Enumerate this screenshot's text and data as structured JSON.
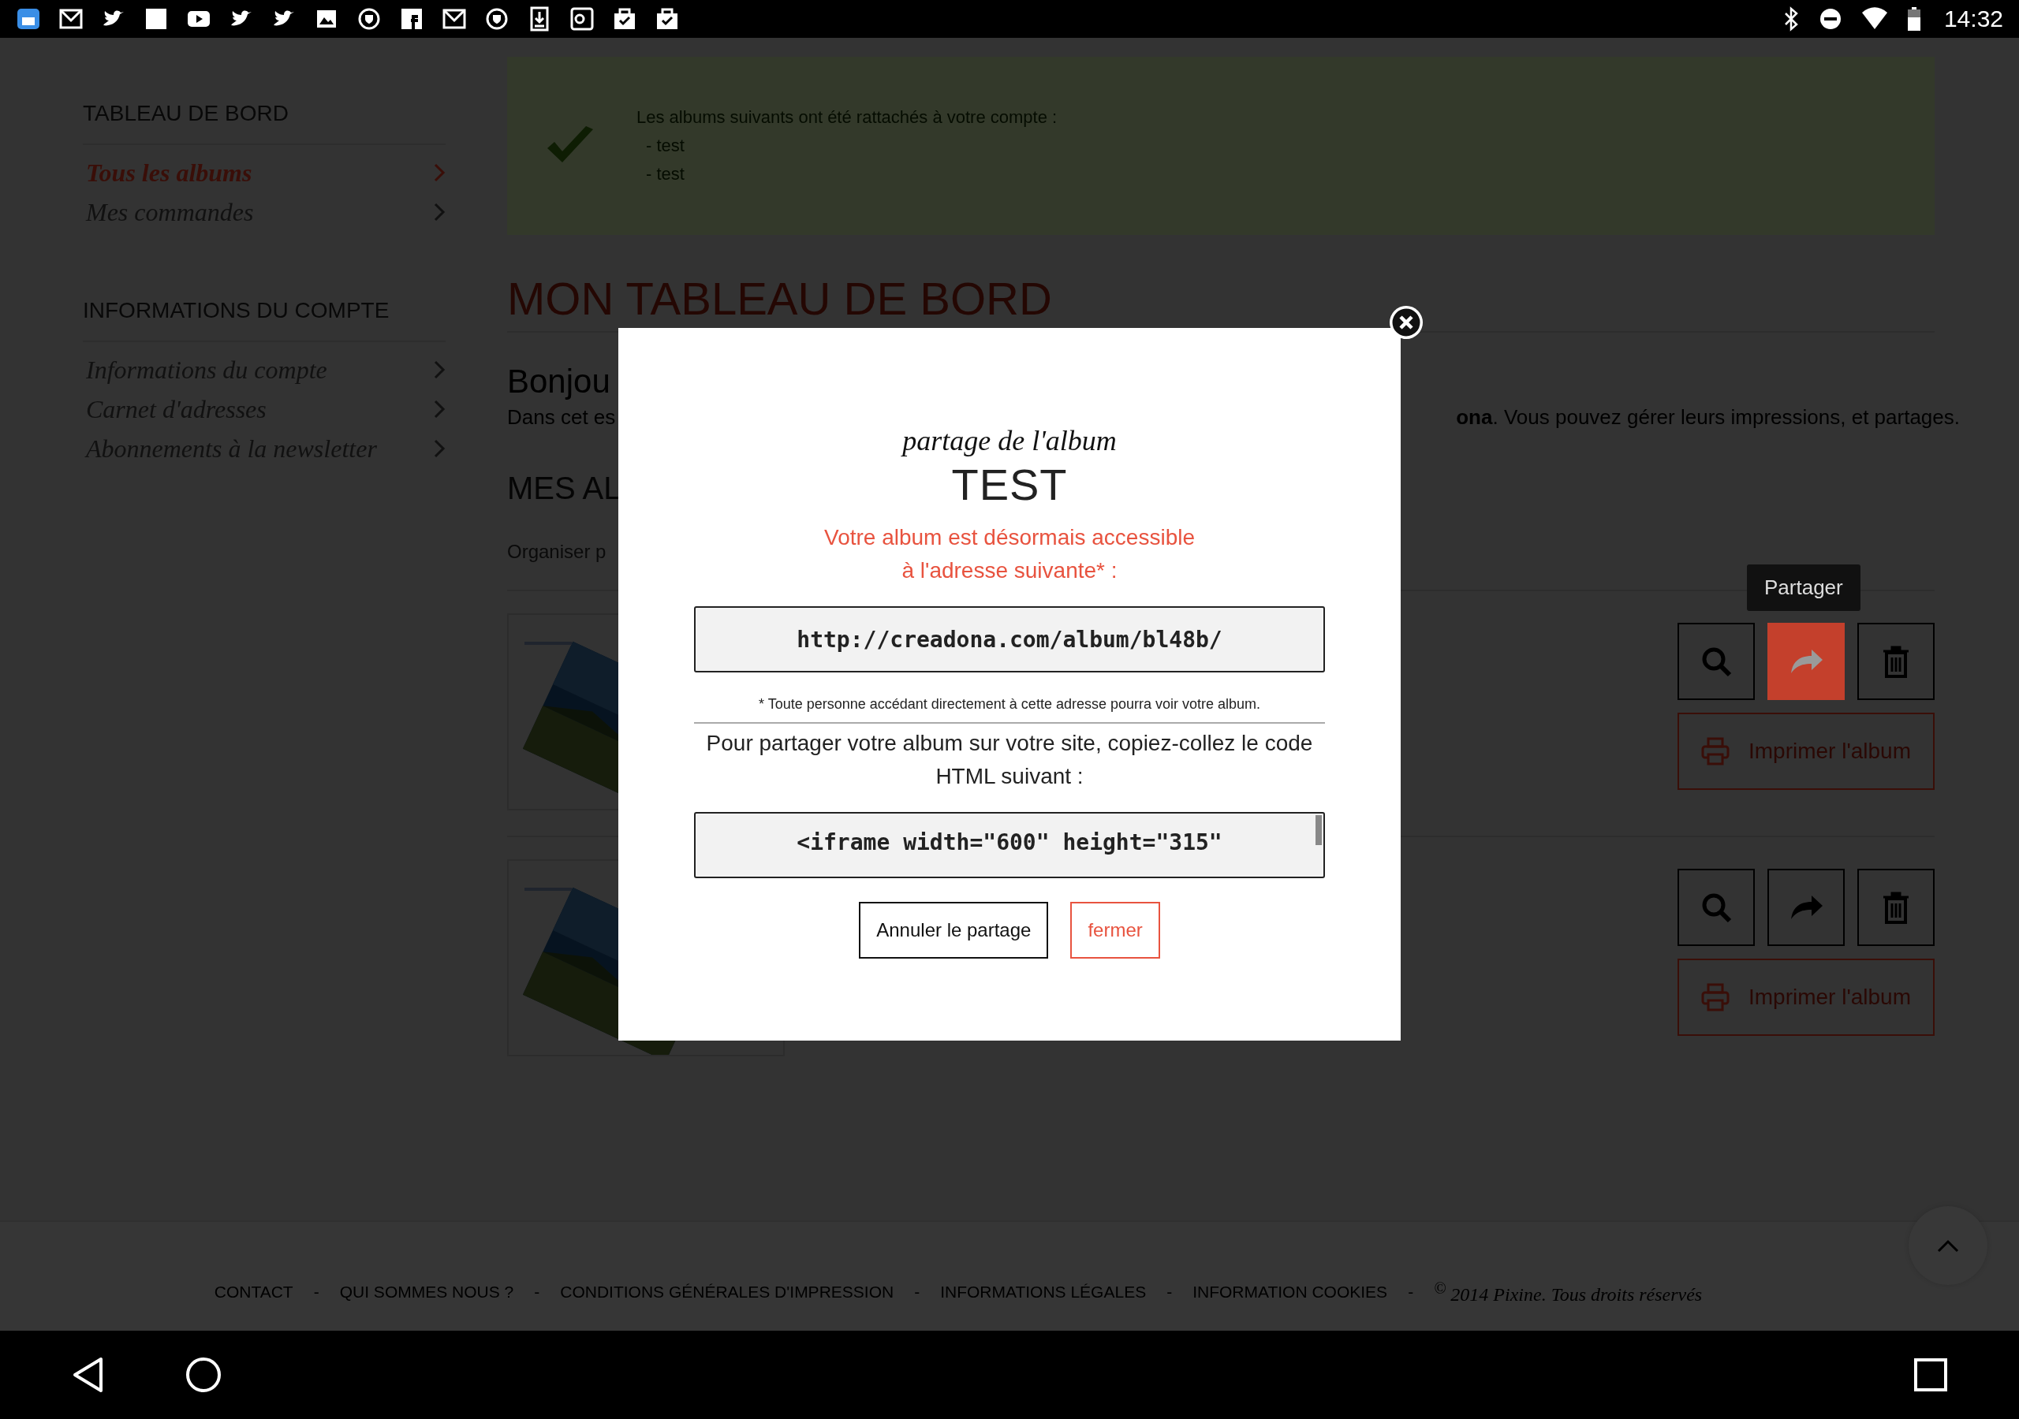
{
  "status_bar": {
    "time": "14:32"
  },
  "sidebar": {
    "sections": [
      {
        "title": "TABLEAU DE BORD",
        "items": [
          {
            "label": "Tous les albums",
            "selected": true
          },
          {
            "label": "Mes commandes",
            "selected": false
          }
        ]
      },
      {
        "title": "INFORMATIONS DU COMPTE",
        "items": [
          {
            "label": "Informations du compte",
            "selected": false
          },
          {
            "label": "Carnet d'adresses",
            "selected": false
          },
          {
            "label": "Abonnements à la newsletter",
            "selected": false
          }
        ]
      }
    ]
  },
  "notice": {
    "message": "Les albums suivants ont été rattachés à votre compte :",
    "items": [
      "- test",
      "- test"
    ]
  },
  "page_title": "MON TABLEAU DE BORD",
  "greeting": "Bonjou",
  "intro_left": "Dans cet es",
  "intro_right": "**ona**. Vous pouvez gérer leurs impressions, et partages.",
  "albums_heading": "MES AL",
  "organize_label": "Organiser p",
  "albums": [
    {
      "tooltip": "Partager",
      "actions": [
        {
          "kind": "view",
          "highlighted": false
        },
        {
          "kind": "share",
          "highlighted": true
        },
        {
          "kind": "delete",
          "highlighted": false
        }
      ],
      "print_label": "Imprimer l'album"
    },
    {
      "actions": [
        {
          "kind": "view",
          "highlighted": false
        },
        {
          "kind": "share",
          "highlighted": false
        },
        {
          "kind": "delete",
          "highlighted": false
        }
      ],
      "print_label": "Imprimer l'album"
    }
  ],
  "modal": {
    "title": "partage de l'album",
    "album_name": "TEST",
    "notice": "Votre album est désormais accessible\nà l'adresse suivante* :",
    "url": "http://creadona.com/album/bl48b/",
    "footnote": "* Toute personne accédant directement à cette adresse pourra voir votre album.",
    "embed_instructions": "Pour partager votre album sur votre site, copiez-collez le code HTML suivant :",
    "embed_code": "<iframe width=\"600\" height=\"315\"",
    "buttons": [
      {
        "kind": "cancel",
        "label": "Annuler le partage"
      },
      {
        "kind": "close",
        "label": "fermer"
      }
    ]
  },
  "footer": {
    "items": [
      {
        "kind": "link",
        "text": "CONTACT"
      },
      {
        "kind": "separator",
        "text": "-"
      },
      {
        "kind": "link",
        "text": "QUI SOMMES NOUS ?"
      },
      {
        "kind": "separator",
        "text": "-"
      },
      {
        "kind": "link",
        "text": "CONDITIONS GÉNÉRALES D'IMPRESSION"
      },
      {
        "kind": "separator",
        "text": "-"
      },
      {
        "kind": "link",
        "text": "INFORMATIONS LÉGALES"
      },
      {
        "kind": "separator",
        "text": "-"
      },
      {
        "kind": "link",
        "text": "INFORMATION COOKIES"
      },
      {
        "kind": "separator",
        "text": "-"
      },
      {
        "kind": "copyright",
        "text": "$^{©}$ 2014 Pixine. Tous droits réservés"
      }
    ]
  }
}
